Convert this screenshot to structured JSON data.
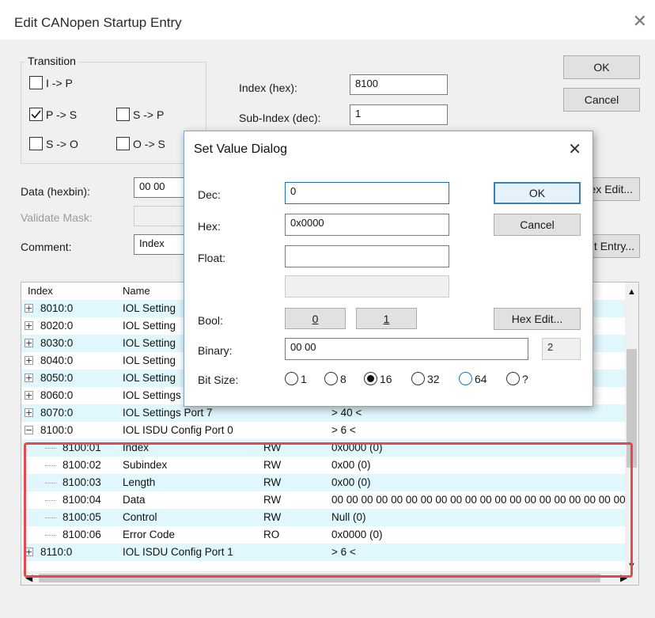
{
  "window": {
    "title": "Edit CANopen Startup Entry",
    "close_icon": "close-icon"
  },
  "transition": {
    "label": "Transition",
    "options": [
      {
        "label": "I -> P",
        "checked": false
      },
      {
        "label": "P -> S",
        "checked": true
      },
      {
        "label": "S -> P",
        "checked": false
      },
      {
        "label": "S -> O",
        "checked": false
      },
      {
        "label": "O -> S",
        "checked": false
      }
    ]
  },
  "fields": {
    "index_label": "Index (hex):",
    "index_value": "8100",
    "subindex_label": "Sub-Index (dec):",
    "subindex_value": "1",
    "data_label": "Data (hexbin):",
    "data_value": "00 00",
    "validate_label": "Validate Mask:",
    "comment_label": "Comment:",
    "comment_value": "Index"
  },
  "buttons": {
    "ok": "OK",
    "cancel": "Cancel",
    "hex_edit_partial": "ex Edit...",
    "edit_entry_partial": "lit Entry..."
  },
  "list": {
    "headers": [
      "Index",
      "Name"
    ],
    "rows": [
      {
        "index": "8010:0",
        "name": "IOL Setting",
        "flag": "",
        "value": "",
        "expander": "+",
        "child": false
      },
      {
        "index": "8020:0",
        "name": "IOL Setting",
        "flag": "",
        "value": "",
        "expander": "+",
        "child": false
      },
      {
        "index": "8030:0",
        "name": "IOL Setting",
        "flag": "",
        "value": "",
        "expander": "+",
        "child": false
      },
      {
        "index": "8040:0",
        "name": "IOL Setting",
        "flag": "",
        "value": "",
        "expander": "+",
        "child": false
      },
      {
        "index": "8050:0",
        "name": "IOL Setting",
        "flag": "",
        "value": "",
        "expander": "+",
        "child": false
      },
      {
        "index": "8060:0",
        "name": "IOL Settings Port 6",
        "flag": "",
        "value": "> 40 <",
        "expander": "+",
        "child": false
      },
      {
        "index": "8070:0",
        "name": "IOL Settings Port 7",
        "flag": "",
        "value": "> 40 <",
        "expander": "+",
        "child": false
      },
      {
        "index": "8100:0",
        "name": "IOL ISDU Config Port 0",
        "flag": "",
        "value": "> 6 <",
        "expander": "−",
        "child": false
      },
      {
        "index": "8100:01",
        "name": "Index",
        "flag": "RW",
        "value": "0x0000 (0)",
        "expander": "",
        "child": true
      },
      {
        "index": "8100:02",
        "name": "Subindex",
        "flag": "RW",
        "value": "0x00 (0)",
        "expander": "",
        "child": true
      },
      {
        "index": "8100:03",
        "name": "Length",
        "flag": "RW",
        "value": "0x00 (0)",
        "expander": "",
        "child": true
      },
      {
        "index": "8100:04",
        "name": "Data",
        "flag": "RW",
        "value": "00 00 00 00 00 00 00 00 00 00 00 00 00 00 00 00 00 00 00 00 0",
        "expander": "",
        "child": true
      },
      {
        "index": "8100:05",
        "name": "Control",
        "flag": "RW",
        "value": "Null (0)",
        "expander": "",
        "child": true
      },
      {
        "index": "8100:06",
        "name": "Error Code",
        "flag": "RO",
        "value": "0x0000 (0)",
        "expander": "",
        "child": true
      },
      {
        "index": "8110:0",
        "name": "IOL ISDU Config Port 1",
        "flag": "",
        "value": "> 6 <",
        "expander": "+",
        "child": false
      }
    ]
  },
  "dialog": {
    "title": "Set Value Dialog",
    "dec_label": "Dec:",
    "dec_value": "0",
    "hex_label": "Hex:",
    "hex_value": "0x0000",
    "float_label": "Float:",
    "float_value": "",
    "bool_label": "Bool:",
    "bool_0": "0",
    "bool_1": "1",
    "binary_label": "Binary:",
    "binary_value": "00 00",
    "binary_count": "2",
    "bitsize_label": "Bit Size:",
    "bit_sizes": [
      {
        "label": "1",
        "selected": false
      },
      {
        "label": "8",
        "selected": false
      },
      {
        "label": "16",
        "selected": true
      },
      {
        "label": "32",
        "selected": false
      },
      {
        "label": "64",
        "selected": false
      },
      {
        "label": "?",
        "selected": false
      }
    ],
    "ok": "OK",
    "cancel": "Cancel",
    "hex_edit": "Hex Edit..."
  },
  "colors": {
    "alt_row": "#e0f7fd",
    "highlight_border": "#e5484d",
    "default_button_border": "#3c7fb1"
  }
}
